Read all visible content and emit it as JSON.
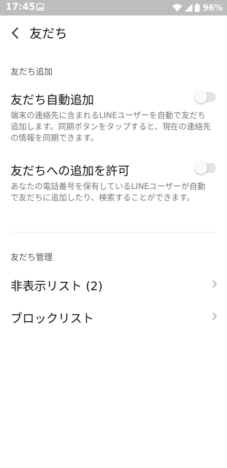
{
  "status_bar": {
    "time": "17:45",
    "battery": "96%",
    "icons": [
      "image-icon",
      "wifi-icon",
      "signal-icon",
      "battery-icon"
    ]
  },
  "header": {
    "title": "友だち",
    "back_icon": "back-arrow-icon"
  },
  "sections": {
    "add": {
      "header": "友だち追加",
      "auto_add": {
        "title": "友だち自動追加",
        "description": "端末の連絡先に含まれるLINEユーザーを自動で友だち追加します。同期ボタンをタップすると、現在の連絡先の情報を同期できます。",
        "enabled": false
      },
      "allow_add": {
        "title": "友だちへの追加を許可",
        "description": "あなたの電話番号を保有しているLINEユーザーが自動で友だちに追加したり、検索することができます。",
        "enabled": false
      }
    },
    "manage": {
      "header": "友だち管理",
      "hidden_list": {
        "label": "非表示リスト (2)"
      },
      "block_list": {
        "label": "ブロックリスト"
      }
    }
  },
  "colors": {
    "status_bar_bg": "#bdbdbd",
    "toggle_track": "#e3e3e3",
    "text_primary": "#111111",
    "text_secondary": "#777777"
  }
}
